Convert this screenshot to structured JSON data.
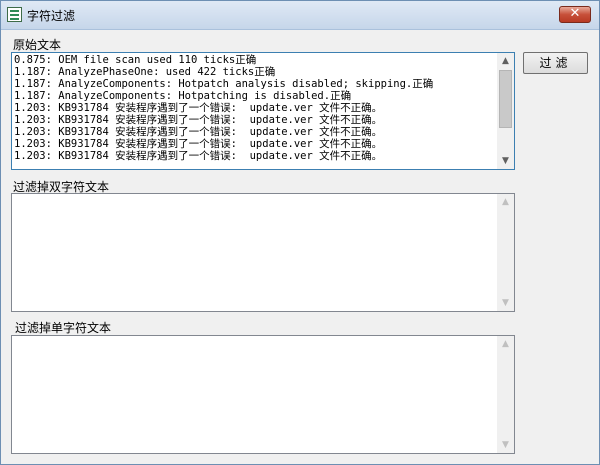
{
  "window": {
    "title": "字符过滤"
  },
  "titlebar": {
    "close_glyph": "✕"
  },
  "original": {
    "label": "原始文本",
    "lines": [
      "0.875: OEM file scan used 110 ticks正确",
      "1.187: AnalyzePhaseOne: used 422 ticks正确",
      "1.187: AnalyzeComponents: Hotpatch analysis disabled; skipping.正确",
      "1.187: AnalyzeComponents: Hotpatching is disabled.正确",
      "1.203: KB931784 安装程序遇到了一个错误:  update.ver 文件不正确。",
      "1.203: KB931784 安装程序遇到了一个错误:  update.ver 文件不正确。",
      "1.203: KB931784 安装程序遇到了一个错误:  update.ver 文件不正确。",
      "1.203: KB931784 安装程序遇到了一个错误:  update.ver 文件不正确。",
      "1.203: KB931784 安装程序遇到了一个错误:  update.ver 文件不正确。"
    ]
  },
  "filter_button": {
    "label": "过滤"
  },
  "double_byte": {
    "label": "过滤掉双字符文本",
    "value": ""
  },
  "single_byte": {
    "label": "过滤掉单字符文本",
    "value": ""
  },
  "icons": {
    "app": "app-icon",
    "up": "chevron-up-icon",
    "down": "chevron-down-icon"
  }
}
